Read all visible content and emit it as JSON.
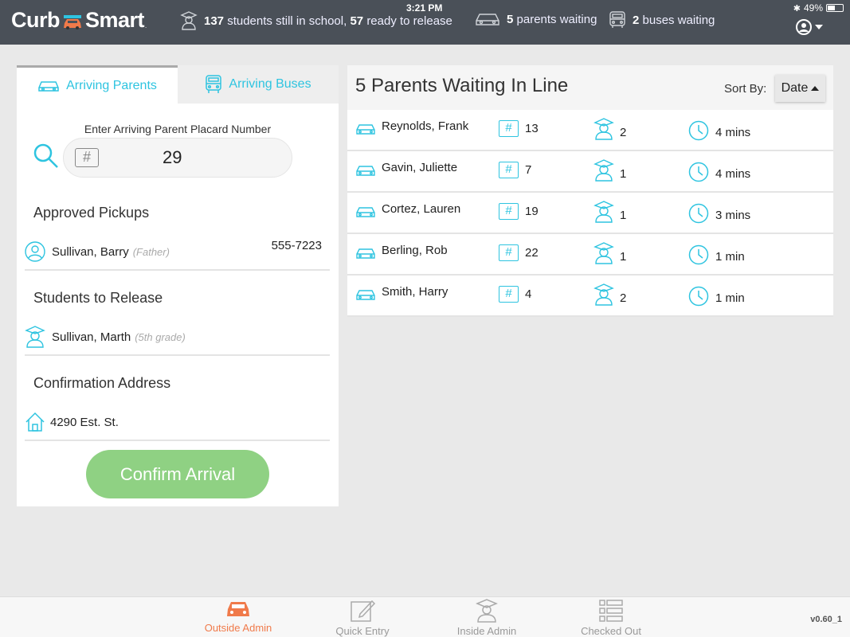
{
  "status_bar": {
    "time": "3:21 PM",
    "battery": "49%"
  },
  "header": {
    "logo_left": "Curb",
    "logo_right": "Smart",
    "logo_tm": ".",
    "stats": {
      "students_count": "137",
      "students_text": "students still in school,",
      "ready_count": "57",
      "ready_text": "ready to release",
      "parents_count": "5",
      "parents_text": "parents waiting",
      "buses_count": "2",
      "buses_text": "buses waiting"
    }
  },
  "left_panel": {
    "tabs": [
      {
        "label": "Arriving Parents",
        "active": true
      },
      {
        "label": "Arriving Buses",
        "active": false
      }
    ],
    "placard_label": "Enter Arriving Parent Placard Number",
    "placard_hash": "#",
    "placard_value": "29",
    "approved_pickups_title": "Approved Pickups",
    "pickup": {
      "name": "Sullivan, Barry",
      "relation": "(Father)",
      "phone": "555-7223"
    },
    "students_title": "Students to Release",
    "student": {
      "name": "Sullivan, Marth",
      "grade": "(5th grade)"
    },
    "address_title": "Confirmation Address",
    "address": "4290 Est. St.",
    "confirm_label": "Confirm Arrival"
  },
  "right_panel": {
    "title": "5 Parents Waiting In Line",
    "sort_label": "Sort By:",
    "sort_value": "Date",
    "rows": [
      {
        "name": "Reynolds, Frank",
        "hash": "#",
        "placard": "13",
        "students": "2",
        "wait": "4 mins"
      },
      {
        "name": "Gavin, Juliette",
        "hash": "#",
        "placard": "7",
        "students": "1",
        "wait": "4 mins"
      },
      {
        "name": "Cortez, Lauren",
        "hash": "#",
        "placard": "19",
        "students": "1",
        "wait": "3 mins"
      },
      {
        "name": "Berling, Rob",
        "hash": "#",
        "placard": "22",
        "students": "1",
        "wait": "1 min"
      },
      {
        "name": "Smith, Harry",
        "hash": "#",
        "placard": "4",
        "students": "2",
        "wait": "1 min"
      }
    ]
  },
  "bottom_nav": {
    "items": [
      {
        "label": "Outside Admin",
        "active": true
      },
      {
        "label": "Quick Entry",
        "active": false
      },
      {
        "label": "Inside Admin",
        "active": false
      },
      {
        "label": "Checked Out",
        "active": false
      }
    ],
    "version": "v0.60_1"
  },
  "colors": {
    "accent": "#2ec4e0",
    "header": "#4a5058",
    "confirm": "#8fd183",
    "active_nav": "#f07a4a"
  }
}
